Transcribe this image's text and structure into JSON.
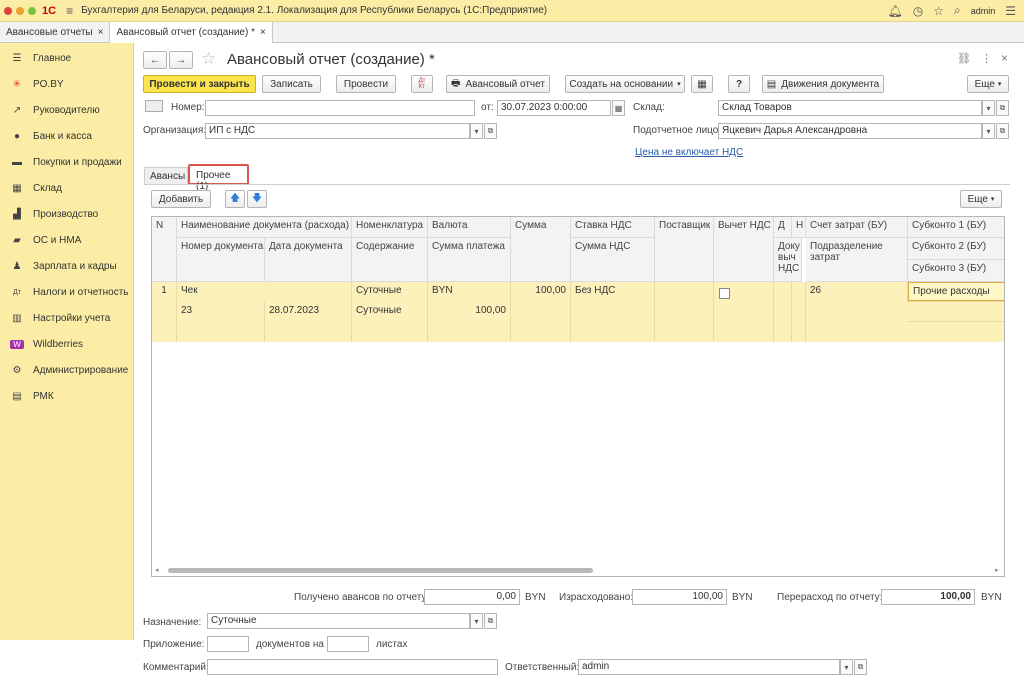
{
  "titlebar": {
    "logo": "1С",
    "title": "Бухгалтерия для Беларуси, редакция 2.1. Локализация для Республики Беларусь  (1С:Предприятие)",
    "user": "admin"
  },
  "open_tabs": [
    {
      "label": "Авансовые отчеты"
    },
    {
      "label": "Авансовый отчет (создание) *"
    }
  ],
  "sidebar": {
    "items": [
      {
        "label": "Главное",
        "icon": "☰"
      },
      {
        "label": "PO.BY",
        "icon": "✳"
      },
      {
        "label": "Руководителю",
        "icon": "↗"
      },
      {
        "label": "Банк и касса",
        "icon": "●"
      },
      {
        "label": "Покупки и продажи",
        "icon": "▬"
      },
      {
        "label": "Склад",
        "icon": "▦"
      },
      {
        "label": "Производство",
        "icon": "▟"
      },
      {
        "label": "ОС и НМА",
        "icon": "▰"
      },
      {
        "label": "Зарплата и кадры",
        "icon": "♟"
      },
      {
        "label": "Налоги и отчетность",
        "icon": "Дт"
      },
      {
        "label": "Настройки учета",
        "icon": "▥"
      },
      {
        "label": "Wildberries",
        "icon": "W"
      },
      {
        "label": "Администрирование",
        "icon": "⚙"
      },
      {
        "label": "РМК",
        "icon": "▤"
      }
    ]
  },
  "form": {
    "title": "Авансовый отчет (создание) *"
  },
  "toolbar": {
    "post_close": "Провести и закрыть",
    "write": "Записать",
    "post": "Провести",
    "print": "Авансовый отчет",
    "create_based": "Создать на основании",
    "help": "?",
    "movements": "Движения документа",
    "more": "Еще"
  },
  "header": {
    "number_label": "Номер:",
    "number": "",
    "date_label": "от:",
    "date": "30.07.2023  0:00:00",
    "warehouse_label": "Склад:",
    "warehouse": "Склад Товаров",
    "org_label": "Организация:",
    "org": "ИП с НДС",
    "person_label": "Подотчетное лицо:",
    "person": "Яцкевич Дарья Александровна",
    "vat_link": "Цена не включает НДС"
  },
  "doc_tabs": [
    {
      "label": "Авансы"
    },
    {
      "label": "Прочее (1)"
    }
  ],
  "grid_toolbar": {
    "add": "Добавить",
    "more": "Еще"
  },
  "grid": {
    "headers": {
      "n": "N",
      "doc_name": "Наименование документа (расхода)",
      "doc_number": "Номер документа",
      "doc_date": "Дата документа",
      "nomen": "Номенклатура",
      "content": "Содержание",
      "currency": "Валюта",
      "pay_sum": "Сумма платежа",
      "sum": "Сумма",
      "vat_rate": "Ставка НДС",
      "vat_sum": "Сумма НДС",
      "supplier": "Поставщик",
      "vat_deduct": "Вычет НДС",
      "d": "Д",
      "doc_vat": "Доку выч НДС",
      "h": "Н",
      "cost_acc": "Счет затрат (БУ)",
      "division": "Подразделение затрат",
      "sub1": "Субконто 1 (БУ)",
      "sub2": "Субконто 2 (БУ)",
      "sub3": "Субконто 3 (БУ)"
    },
    "rows": [
      {
        "n": "1",
        "doc_name": "Чек",
        "doc_number": "23",
        "doc_date": "28.07.2023",
        "nomen": "Суточные",
        "content": "Суточные",
        "currency": "BYN",
        "pay_sum": "100,00",
        "sum": "100,00",
        "vat_rate": "Без НДС",
        "cost_acc": "26",
        "sub1": "Прочие расходы"
      }
    ]
  },
  "totals": {
    "advances_label": "Получено авансов по отчету:",
    "advances": "0,00",
    "spent_label": "Израсходовано:",
    "spent": "100,00",
    "over_label": "Перерасход по отчету:",
    "over": "100,00",
    "cur": "BYN"
  },
  "footer": {
    "purpose_label": "Назначение:",
    "purpose": "Суточные",
    "attach_label": "Приложение:",
    "docs_on": "документов на",
    "sheets": "листах",
    "comment_label": "Комментарий:",
    "resp_label": "Ответственный:",
    "resp": "admin"
  }
}
